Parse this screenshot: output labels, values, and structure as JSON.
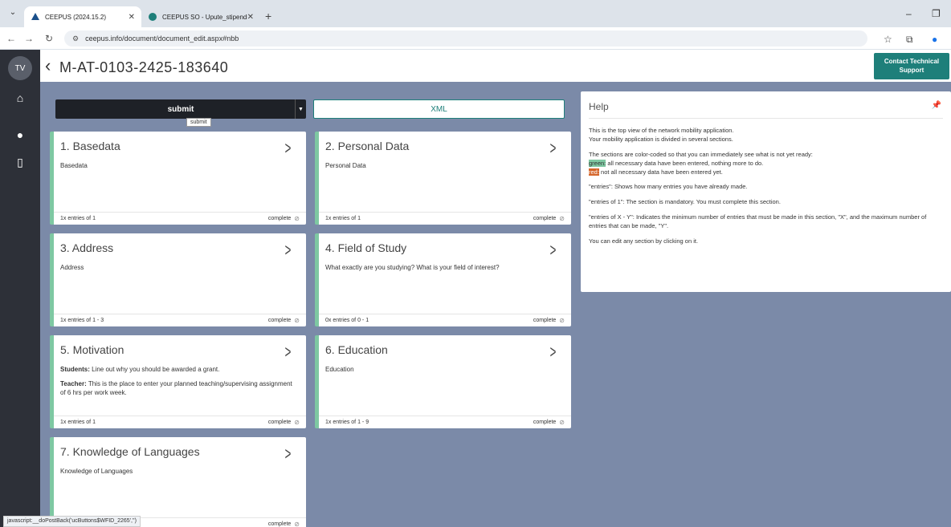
{
  "browser": {
    "tabs": [
      {
        "title": "CEEPUS (2024.15.2)",
        "active": true
      },
      {
        "title": "CEEPUS SO - Upute_stipendisti",
        "active": false
      }
    ],
    "url": "ceepus.info/document/document_edit.aspx#nbb",
    "status_url": "javascript:__doPostBack('ucButtons$WFID_2265','')"
  },
  "rail": {
    "avatar_initials": "TV"
  },
  "header": {
    "title": "M-AT-0103-2425-183640",
    "support_label_line1": "Contact Technical",
    "support_label_line2": "Support"
  },
  "actions": {
    "submit_label": "submit",
    "submit_tooltip": "submit",
    "xml_label": "XML"
  },
  "cards": [
    {
      "title": "1. Basedata",
      "desc": "Basedata",
      "entries": "1x entries of 1",
      "status": "complete"
    },
    {
      "title": "2. Personal Data",
      "desc": "Personal Data",
      "entries": "1x entries of 1",
      "status": "complete"
    },
    {
      "title": "3. Address",
      "desc": "Address",
      "entries": "1x entries of 1 - 3",
      "status": "complete"
    },
    {
      "title": "4. Field of Study",
      "desc": "What exactly are you studying? What is your field of interest?",
      "entries": "0x entries of 0 - 1",
      "status": "complete"
    },
    {
      "title": "5. Motivation",
      "desc_students_label": "Students:",
      "desc_students": " Line out why you should be awarded a grant.",
      "desc_teacher_label": "Teacher:",
      "desc_teacher": " This is the place to enter your planned teaching/supervising assignment of 6 hrs per work week.",
      "entries": "1x entries of 1",
      "status": "complete"
    },
    {
      "title": "6. Education",
      "desc": "Education",
      "entries": "1x entries of 1 - 9",
      "status": "complete"
    },
    {
      "title": "7. Knowledge of Languages",
      "desc": "Knowledge of Languages",
      "entries": "",
      "status": "complete"
    }
  ],
  "help": {
    "title": "Help",
    "p1": "This is the top view of the network mobility application.",
    "p1b": "Your mobility application is divided in several sections.",
    "p2": "The sections are color-coded so that you can immediately see what is not yet ready:",
    "green_tag": "green:",
    "green_text": " all necessary data have been entered, nothing more to do.",
    "red_tag": "red:",
    "red_text": " not all necessary data have been entered yet.",
    "p3": "\"entries\": Shows how many entries you have already made.",
    "p4": "\"entries of 1\": The section is mandatory. You must complete this section.",
    "p5": "\"entries of X - Y\": Indicates the minimum number of entries that must be made in this section, \"X\", and the maximum number of entries that can be made, \"Y\".",
    "p6": "You can edit any section by clicking on it."
  }
}
